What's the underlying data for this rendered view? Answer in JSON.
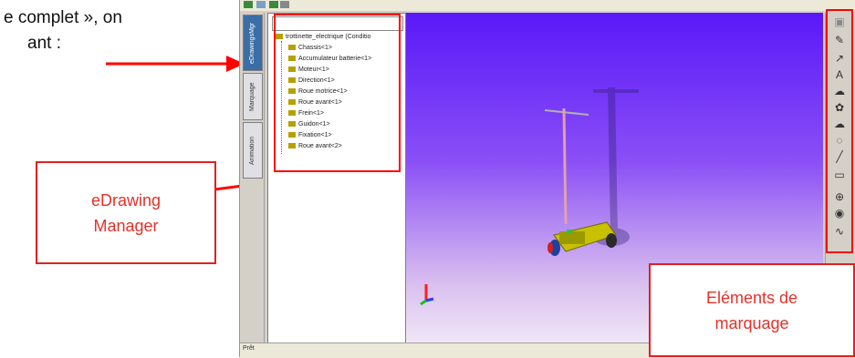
{
  "intro": {
    "line1": "e complet », on",
    "line2": "ant :"
  },
  "app": {
    "side_tabs": [
      "eDrawingsMgr",
      "Marquage",
      "Animation"
    ],
    "tree_root": "trottinette_electrique (Conditio",
    "tree_items": [
      "Chassis<1>",
      "Accumulateur batterie<1>",
      "Moteur<1>",
      "Direction<1>",
      "Roue motrice<1>",
      "Roue avant<1>",
      "Frein<1>",
      "Guidon<1>",
      "Fixation<1>",
      "Roue avant<2>"
    ],
    "markup_icons": [
      "lock-icon",
      "pencil-icon",
      "arrow-icon",
      "text-icon",
      "cloud-icon",
      "bubble-icon",
      "cloud-icon",
      "curve-icon",
      "line-icon",
      "rectangle-icon",
      "circle-icon",
      "target-icon",
      "freehand-icon"
    ],
    "status_text": "Prêt"
  },
  "callouts": {
    "manager": {
      "line1": "eDrawing",
      "line2": "Manager"
    },
    "markup": {
      "line1": "Eléments de",
      "line2": "marquage"
    }
  },
  "colors": {
    "accent_red": "#e3312a",
    "viewport_top": "#5a18f8",
    "viewport_bottom": "#f0e6f6"
  }
}
